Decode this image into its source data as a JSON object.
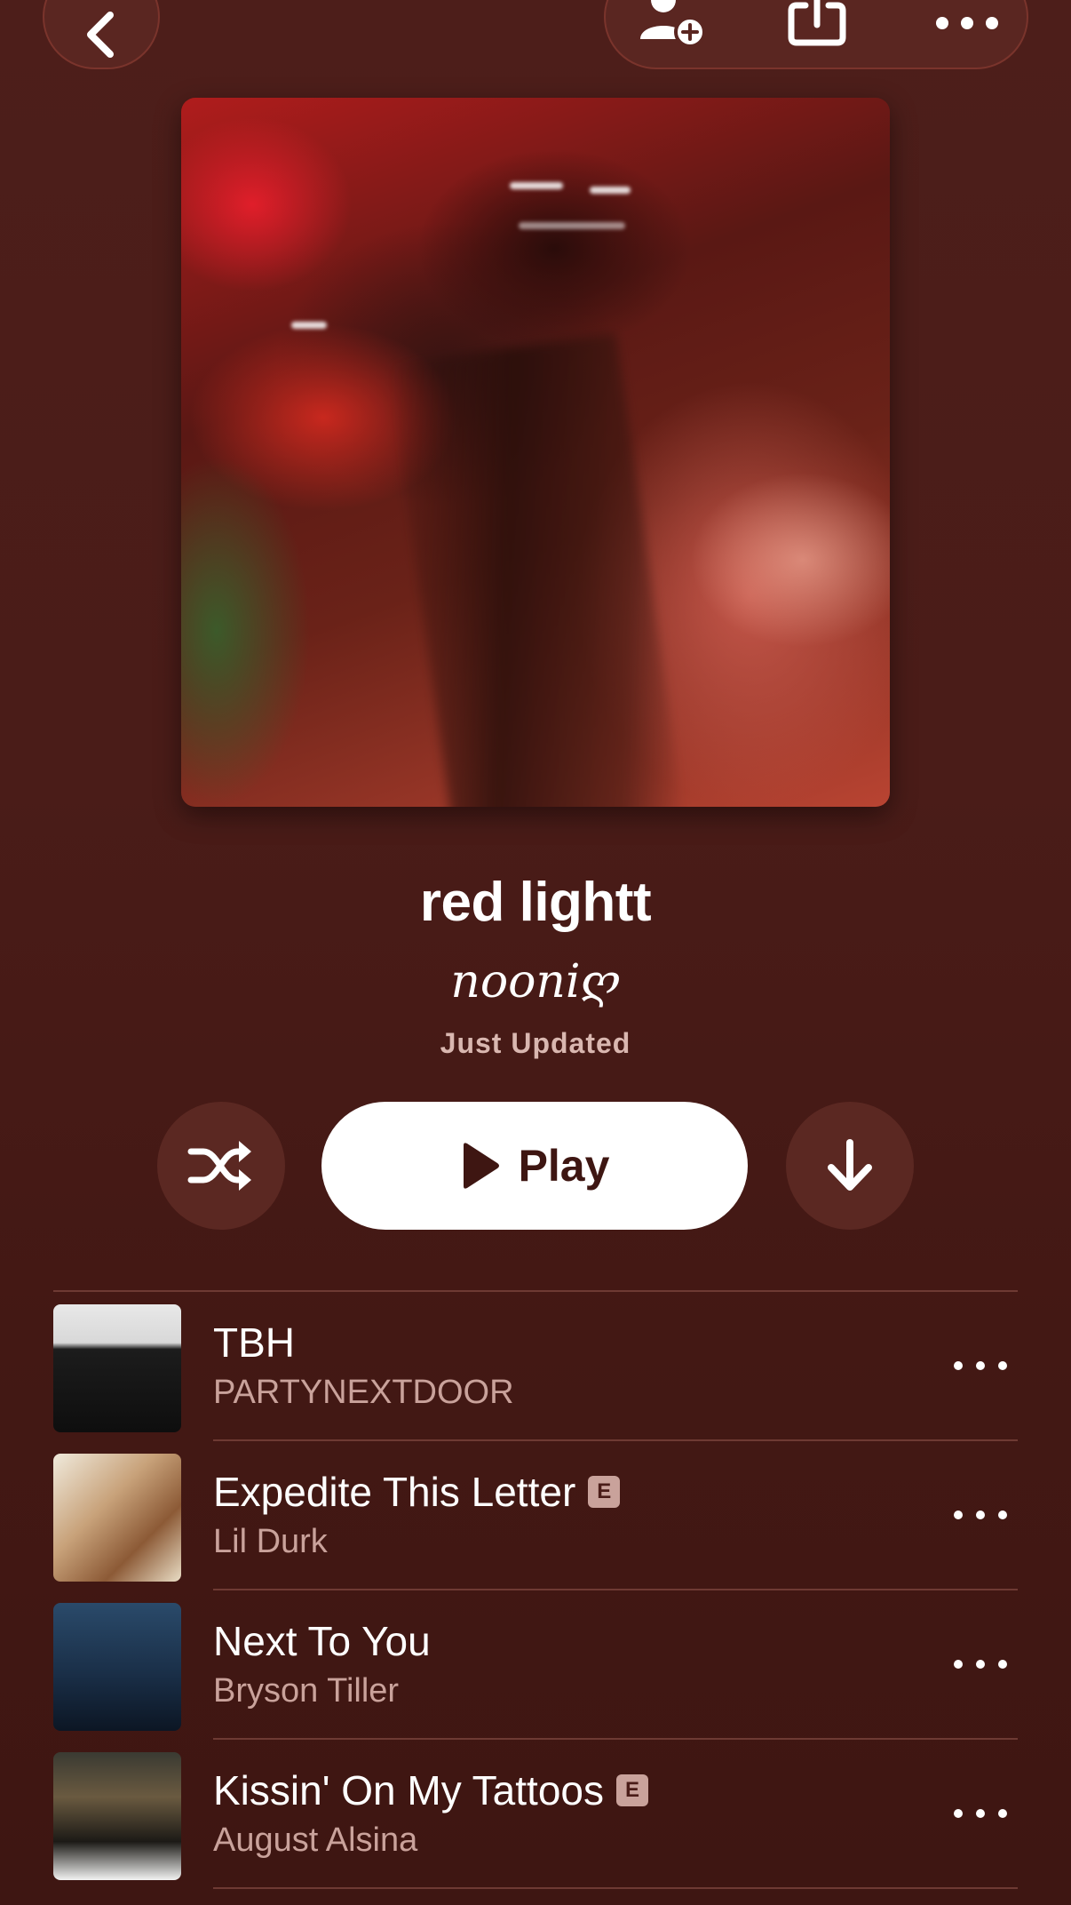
{
  "nav": {
    "back_icon": "chevron-left-icon",
    "actions": [
      "add-collaborator-icon",
      "share-icon",
      "more-icon"
    ]
  },
  "playlist": {
    "title": "red lightt",
    "curator": "nooniღ",
    "status": "Just Updated"
  },
  "controls": {
    "shuffle_icon": "shuffle-icon",
    "play_label": "Play",
    "download_icon": "download-icon"
  },
  "tracks": [
    {
      "title": "TBH",
      "artist": "PARTYNEXTDOOR",
      "explicit": false
    },
    {
      "title": "Expedite This Letter",
      "artist": "Lil Durk",
      "explicit": true,
      "explicit_label": "E"
    },
    {
      "title": "Next To You",
      "artist": "Bryson Tiller",
      "explicit": false
    },
    {
      "title": "Kissin' On My Tattoos",
      "artist": "August Alsina",
      "explicit": true,
      "explicit_label": "E"
    }
  ],
  "colors": {
    "background": "#4a1c18",
    "button_bg": "#5b2822",
    "secondary_text": "#c9a29b",
    "play_text": "#3e1612"
  }
}
